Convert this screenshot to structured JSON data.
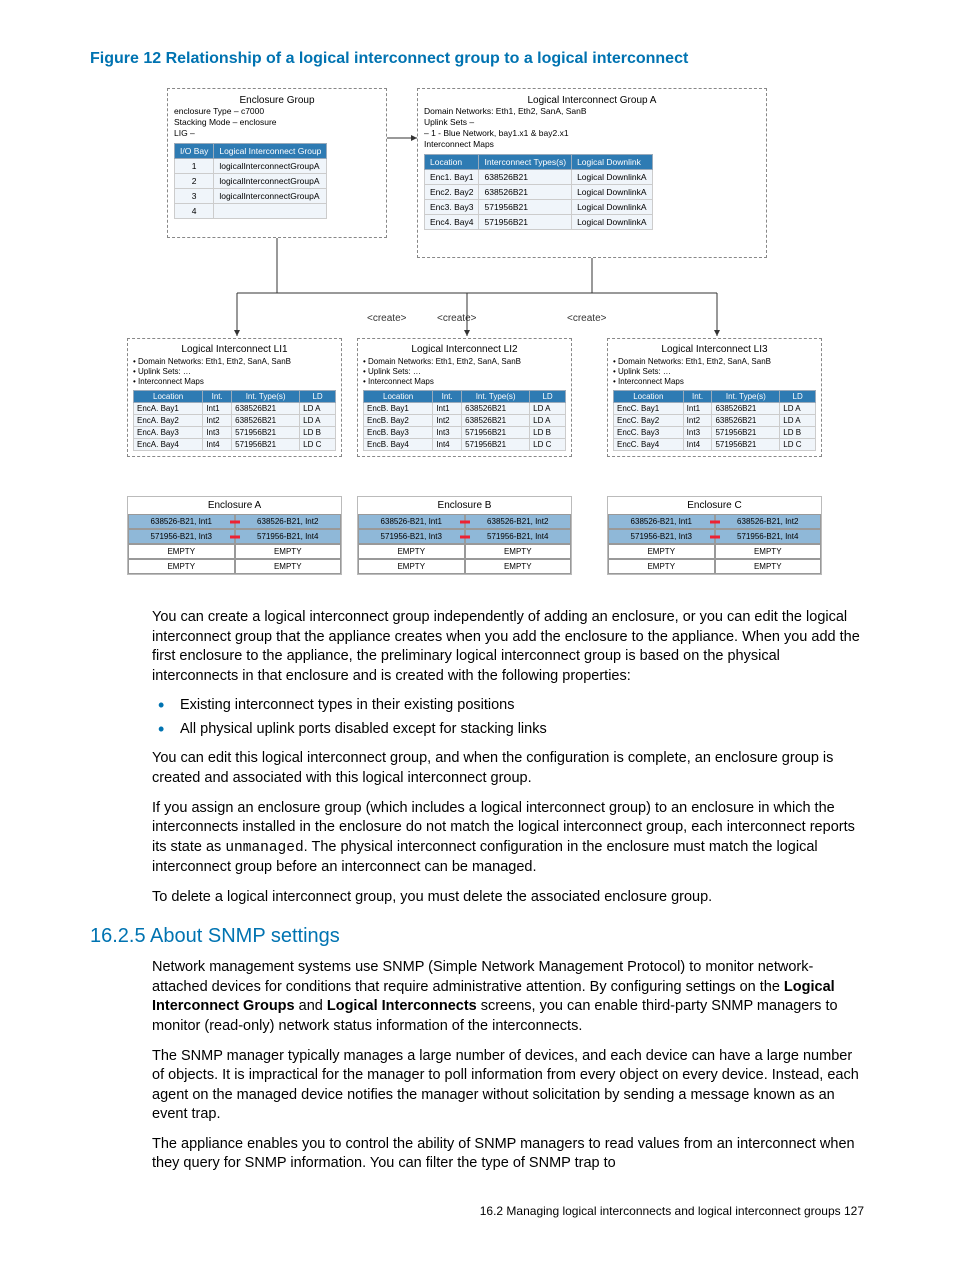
{
  "figure_label": "Figure 12 Relationship of a logical interconnect group to a logical interconnect",
  "enclosure_group": {
    "title": "Enclosure Group",
    "lines": [
      "enclosure Type – c7000",
      "Stacking Mode – enclosure",
      "LIG –"
    ],
    "hdr_io": "I/O Bay",
    "hdr_lig": "Logical Interconnect Group",
    "rows": [
      {
        "bay": "1",
        "lig": "logicalInterconnectGroupA"
      },
      {
        "bay": "2",
        "lig": "logicalInterconnectGroupA"
      },
      {
        "bay": "3",
        "lig": "logicalInterconnectGroupA"
      },
      {
        "bay": "4",
        "lig": ""
      }
    ]
  },
  "lig": {
    "title": "Logical Interconnect Group A",
    "lines": [
      "Domain Networks: Eth1, Eth2, SanA, SanB",
      "Uplink Sets –",
      "–   1 - Blue Network, bay1.x1 & bay2.x1",
      "Interconnect Maps"
    ],
    "hdr_loc": "Location",
    "hdr_it": "Interconnect Types(s)",
    "hdr_ld": "Logical Downlink",
    "rows": [
      {
        "loc": "Enc1. Bay1",
        "it": "638526B21",
        "ld": "Logical DownlinkA"
      },
      {
        "loc": "Enc2. Bay2",
        "it": "638526B21",
        "ld": "Logical DownlinkA"
      },
      {
        "loc": "Enc3. Bay3",
        "it": "571956B21",
        "ld": "Logical DownlinkA"
      },
      {
        "loc": "Enc4. Bay4",
        "it": "571956B21",
        "ld": "Logical DownlinkA"
      }
    ]
  },
  "create": "<create>",
  "li_common": {
    "bullets": [
      "• Domain Networks: Eth1, Eth2, SanA, SanB",
      "• Uplink Sets: …",
      "• Interconnect Maps"
    ],
    "hdr": {
      "loc": "Location",
      "int": "Int.",
      "it": "Int. Type(s)",
      "ld": "LD"
    }
  },
  "li": [
    {
      "title": "Logical Interconnect LI1",
      "prefix": "EncA",
      "enc_title": "Enclosure A"
    },
    {
      "title": "Logical Interconnect LI2",
      "prefix": "EncB",
      "enc_title": "Enclosure B"
    },
    {
      "title": "Logical Interconnect LI3",
      "prefix": "EncC",
      "enc_title": "Enclosure C"
    }
  ],
  "li_rows": [
    {
      "bay": "Bay1",
      "int": "Int1",
      "it": "638526B21",
      "ld": "LD A"
    },
    {
      "bay": "Bay2",
      "int": "Int2",
      "it": "638526B21",
      "ld": "LD A"
    },
    {
      "bay": "Bay3",
      "int": "Int3",
      "it": "571956B21",
      "ld": "LD B"
    },
    {
      "bay": "Bay4",
      "int": "Int4",
      "it": "571956B21",
      "ld": "LD C"
    }
  ],
  "enc_cells": [
    {
      "t": "638526-B21, Int1",
      "c": "fill-blue"
    },
    {
      "t": "638526-B21, Int2",
      "c": "fill-blue"
    },
    {
      "t": "571956-B21, Int3",
      "c": "fill-blue"
    },
    {
      "t": "571956-B21, Int4",
      "c": "fill-blue"
    },
    {
      "t": "EMPTY",
      "c": "fill-white"
    },
    {
      "t": "EMPTY",
      "c": "fill-white"
    },
    {
      "t": "EMPTY",
      "c": "fill-white"
    },
    {
      "t": "EMPTY",
      "c": "fill-white"
    }
  ],
  "para1": "You can create a logical interconnect group independently of adding an enclosure, or you can edit the logical interconnect group that the appliance creates when you add the enclosure to the appliance. When you add the first enclosure to the appliance, the preliminary logical interconnect group is based on the physical interconnects in that enclosure and is created with the following properties:",
  "bullet1": "Existing interconnect types in their existing positions",
  "bullet2": "All physical uplink ports disabled except for stacking links",
  "para2": "You can edit this logical interconnect group, and when the configuration is complete, an enclosure group is created and associated with this logical interconnect group.",
  "para3a": "If you assign an enclosure group (which includes a logical interconnect group) to an enclosure in which the interconnects installed in the enclosure do not match the logical interconnect group, each interconnect reports its state as ",
  "para3code": "unmanaged",
  "para3b": ". The physical interconnect configuration in the enclosure must match the logical interconnect group before an interconnect can be managed.",
  "para4": "To delete a logical interconnect group, you must delete the associated enclosure group.",
  "section": "16.2.5 About SNMP settings",
  "snmp1a": "Network management systems use SNMP (Simple Network Management Protocol) to monitor network-attached devices for conditions that require administrative attention. By configuring settings on the ",
  "snmp1b": "Logical Interconnect Groups",
  "snmp1c": " and ",
  "snmp1d": "Logical Interconnects",
  "snmp1e": " screens, you can enable third-party SNMP managers to monitor (read-only) network status information of the interconnects.",
  "snmp2": "The SNMP manager typically manages a large number of devices, and each device can have a large number of objects. It is impractical for the manager to poll information from every object on every device. Instead, each agent on the managed device notifies the manager without solicitation by sending a message known as an event trap.",
  "snmp3": "The appliance enables you to control the ability of SNMP managers to read values from an interconnect when they query for SNMP information. You can filter the type of SNMP trap to",
  "footer": "16.2 Managing logical interconnects and logical interconnect groups   127"
}
